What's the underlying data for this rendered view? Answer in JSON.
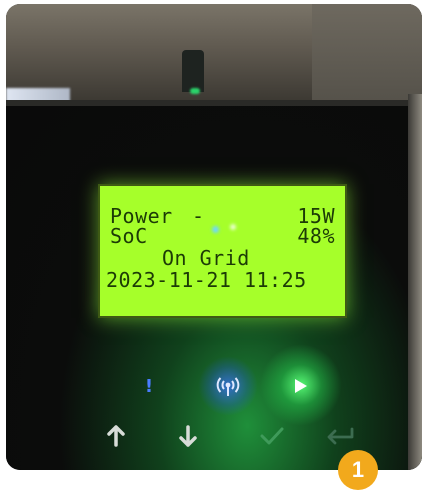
{
  "lcd": {
    "line1_label": "Power",
    "line1_value": "15W",
    "line2_label": "SoC",
    "line2_value": "48%",
    "line3": "On Grid",
    "line4": "2023-11-21 11:25"
  },
  "indicators": [
    {
      "icon": "warning-icon",
      "color": "#4a7cff"
    },
    {
      "icon": "wireless-signal-icon",
      "color": "#3a78ff"
    },
    {
      "icon": "play-icon",
      "color": "#5dff7a"
    }
  ],
  "keys": [
    {
      "icon": "arrow-up-icon"
    },
    {
      "icon": "arrow-down-icon"
    },
    {
      "icon": "check-icon"
    },
    {
      "icon": "enter-icon"
    }
  ],
  "badge": {
    "label": "1",
    "color": "#f2a91c"
  },
  "colors": {
    "lcd_background": "#a6ff2a",
    "lcd_text": "#1c3b06"
  }
}
